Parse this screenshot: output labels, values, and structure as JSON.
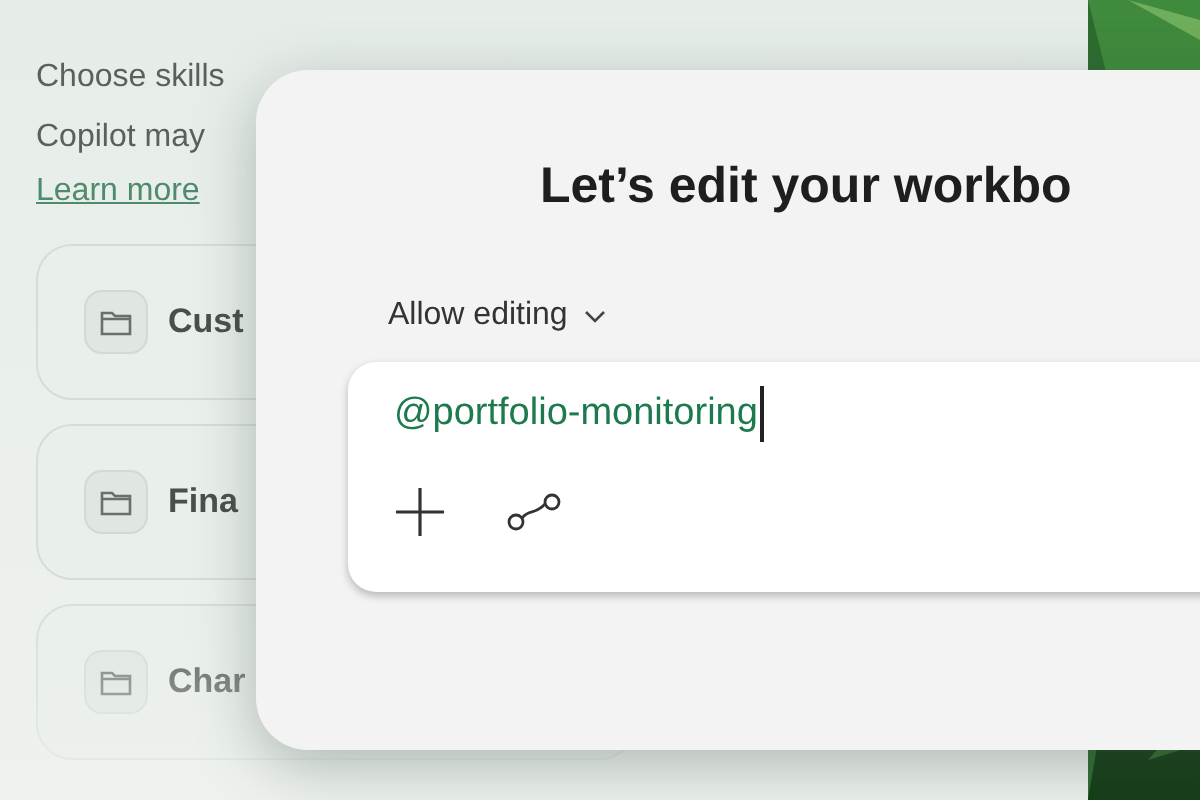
{
  "panel": {
    "description_lines": [
      "Choose skills",
      "Copilot may"
    ],
    "link": "Learn more",
    "skills": [
      {
        "name": "Cust"
      },
      {
        "name": "Fina"
      },
      {
        "name": "Char"
      }
    ]
  },
  "dialog": {
    "title": "Let’s edit your workbo",
    "mode": "Allow editing",
    "prompt": {
      "value": "@portfolio-monitoring"
    }
  }
}
